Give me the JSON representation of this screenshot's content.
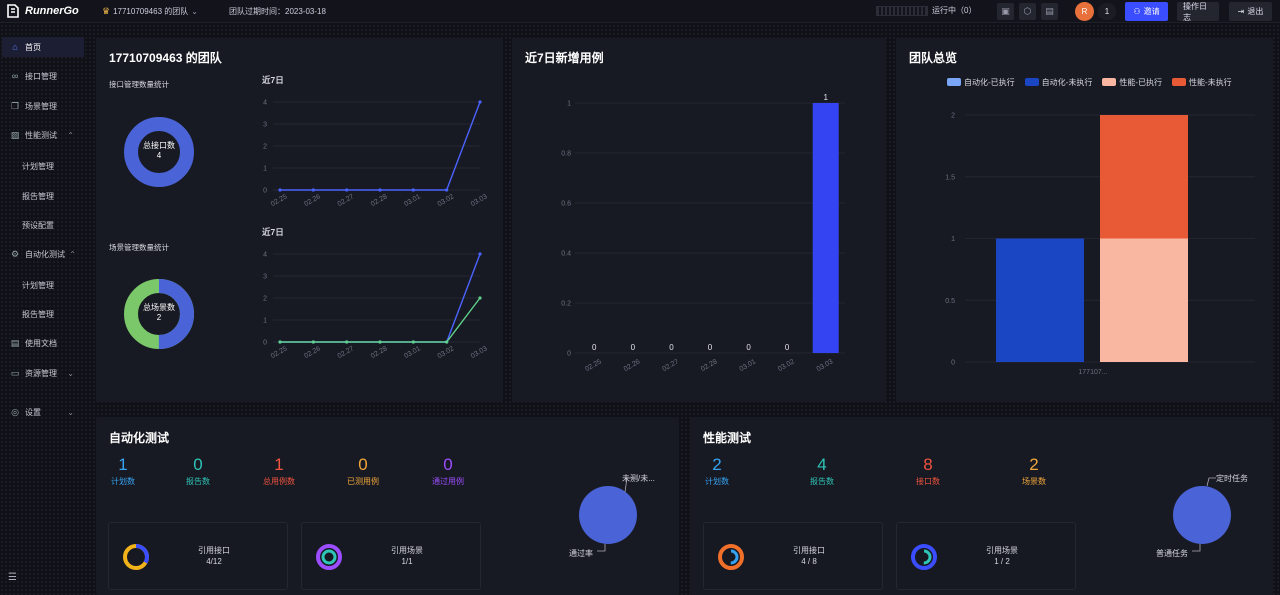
{
  "header": {
    "logo": "RunnerGo",
    "team_name": "17710709463 的团队",
    "expire_text": "团队过期时间：2023-03-18",
    "running_text": "运行中（0）",
    "avatar_text": "R",
    "message_count": "1",
    "invite": "邀请",
    "operation_log": "操作日志",
    "logout": "退出"
  },
  "sidebar": {
    "items": [
      {
        "label": "首页",
        "icon": "home-icon"
      },
      {
        "label": "接口管理",
        "icon": "link-icon"
      },
      {
        "label": "场景管理",
        "icon": "layers-icon"
      },
      {
        "label": "性能测试",
        "icon": "chart-icon"
      },
      {
        "label": "计划管理"
      },
      {
        "label": "报告管理"
      },
      {
        "label": "预设配置"
      },
      {
        "label": "自动化测试",
        "icon": "gear-cluster-icon"
      },
      {
        "label": "计划管理"
      },
      {
        "label": "报告管理"
      },
      {
        "label": "使用文档",
        "icon": "doc-icon"
      },
      {
        "label": "资源管理",
        "icon": "monitor-icon"
      },
      {
        "label": "设置",
        "icon": "settings-icon"
      }
    ]
  },
  "team_panel": {
    "title": "17710709463 的团队",
    "api_stat_label": "接口管理数量统计",
    "api_donut": {
      "label": "总接口数",
      "value": "4"
    },
    "scene_stat_label": "场景管理数量统计",
    "scene_donut": {
      "label": "总场景数",
      "value": "2"
    },
    "chart1_title": "近7日",
    "chart2_title": "近7日"
  },
  "new_cases_panel": {
    "title": "近7日新增用例"
  },
  "overview_panel": {
    "title": "团队总览",
    "legend": [
      "自动化-已执行",
      "自动化-未执行",
      "性能-已执行",
      "性能-未执行"
    ]
  },
  "auto_panel": {
    "title": "自动化测试",
    "stats": [
      {
        "num": "1",
        "label": "计划数"
      },
      {
        "num": "0",
        "label": "报告数"
      },
      {
        "num": "1",
        "label": "总用例数"
      },
      {
        "num": "0",
        "label": "已测用例"
      },
      {
        "num": "0",
        "label": "通过用例"
      }
    ],
    "cards": [
      {
        "label": "引用接口",
        "value": "4/12"
      },
      {
        "label": "引用场景",
        "value": "1/1"
      }
    ],
    "pie_labels": [
      "未测/未...",
      "通过率"
    ]
  },
  "perf_panel": {
    "title": "性能测试",
    "stats": [
      {
        "num": "2",
        "label": "计划数"
      },
      {
        "num": "4",
        "label": "报告数"
      },
      {
        "num": "8",
        "label": "接口数"
      },
      {
        "num": "2",
        "label": "场景数"
      }
    ],
    "cards": [
      {
        "label": "引用接口",
        "value": "4 / 8"
      },
      {
        "label": "引用场景",
        "value": "1 / 2"
      }
    ],
    "pie_labels": [
      "定时任务",
      "普通任务"
    ]
  },
  "colors": {
    "accent": "#3a4dff",
    "donut_blue": "#4a63d6",
    "donut_green": "#7ac86a",
    "bar_blue": "#3544f2",
    "auto_done": "#7aa6f5",
    "auto_todo": "#1a46c4",
    "perf_done": "#f9b7a1",
    "perf_todo": "#e85a35"
  },
  "chart_data": [
    {
      "type": "line",
      "title": "近7日",
      "x": [
        "02.25",
        "02.26",
        "02.27",
        "02.28",
        "03.01",
        "03.02",
        "03.03"
      ],
      "ylim": [
        0,
        4
      ],
      "yticks": [
        0,
        1,
        2,
        3,
        4
      ],
      "series": [
        {
          "values": [
            0,
            0,
            0,
            0,
            0,
            0,
            4
          ]
        }
      ]
    },
    {
      "type": "line",
      "title": "近7日",
      "x": [
        "02.25",
        "02.26",
        "02.27",
        "02.28",
        "03.01",
        "03.02",
        "03.03"
      ],
      "ylim": [
        0,
        4
      ],
      "yticks": [
        0,
        1,
        2,
        3,
        4
      ],
      "series": [
        {
          "values": [
            0,
            0,
            0,
            0,
            0,
            0,
            4
          ]
        },
        {
          "values": [
            0,
            0,
            0,
            0,
            0,
            0,
            2
          ]
        }
      ]
    },
    {
      "type": "bar",
      "title": "近7日新增用例",
      "categories": [
        "02.25",
        "02.26",
        "02.27",
        "02.28",
        "03.01",
        "03.02",
        "03.03"
      ],
      "values": [
        0,
        0,
        0,
        0,
        0,
        0,
        1
      ],
      "ylim": [
        0,
        1
      ],
      "yticks": [
        0,
        0.2,
        0.4,
        0.6,
        0.8,
        1
      ]
    },
    {
      "type": "bar",
      "title": "团队总览",
      "categories": [
        "177107..."
      ],
      "stacked": true,
      "series": [
        {
          "name": "自动化-已执行",
          "values": [
            0
          ]
        },
        {
          "name": "自动化-未执行",
          "values": [
            1
          ]
        },
        {
          "name": "性能-已执行",
          "values": [
            1
          ]
        },
        {
          "name": "性能-未执行",
          "values": [
            1
          ]
        }
      ],
      "ylim": [
        0,
        2
      ],
      "yticks": [
        0,
        0.5,
        1,
        1.5,
        2
      ]
    }
  ]
}
